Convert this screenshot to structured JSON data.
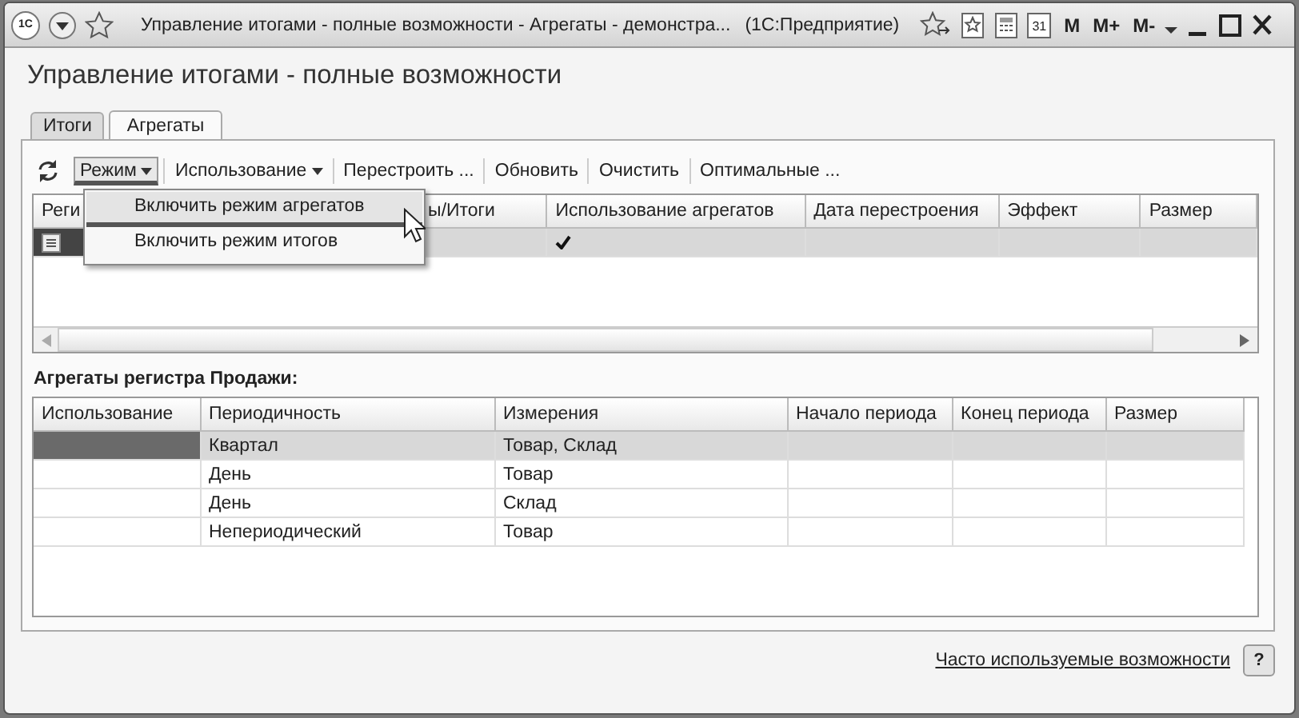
{
  "window": {
    "logo": "1С",
    "title": "Управление итогами - полные возможности - Агрегаты - демонстра...",
    "app": "(1С:Предприятие)",
    "calendar_day": "31",
    "memory_buttons": [
      "M",
      "M+",
      "M-"
    ]
  },
  "form_title": "Управление итогами - полные возможности",
  "tabs": [
    {
      "label": "Итоги",
      "selected": false
    },
    {
      "label": "Агрегаты",
      "selected": true
    }
  ],
  "toolbar": [
    {
      "label": "Режим",
      "dropdown": true,
      "pressed": true
    },
    {
      "label": "Использование",
      "dropdown": true,
      "pressed": false
    },
    {
      "label": "Перестроить ...",
      "dropdown": false,
      "pressed": false
    },
    {
      "label": "Обновить",
      "dropdown": false,
      "pressed": false
    },
    {
      "label": "Очистить",
      "dropdown": false,
      "pressed": false
    },
    {
      "label": "Оптимальные ...",
      "dropdown": false,
      "pressed": false
    }
  ],
  "menu": {
    "items": [
      {
        "label": "Включить режим агрегатов",
        "selected": true
      },
      {
        "label": "Включить режим итогов",
        "selected": false
      }
    ]
  },
  "upper_table": {
    "columns": [
      "Реги",
      "ы/Итоги",
      "Использование агрегатов",
      "Дата перестроения",
      "Эффект",
      "Размер"
    ],
    "rows": [
      {
        "selected": true,
        "usage_checked": true
      }
    ]
  },
  "section_label": "Агрегаты регистра Продажи:",
  "lower_table": {
    "columns": [
      "Использование",
      "Периодичность",
      "Измерения",
      "Начало периода",
      "Конец периода",
      "Размер"
    ],
    "rows": [
      {
        "selected": true,
        "periodicity": "Квартал",
        "dimensions": "Товар, Склад"
      },
      {
        "selected": false,
        "periodicity": "День",
        "dimensions": "Товар"
      },
      {
        "selected": false,
        "periodicity": "День",
        "dimensions": "Склад"
      },
      {
        "selected": false,
        "periodicity": "Непериодический",
        "dimensions": "Товар"
      }
    ]
  },
  "footer": {
    "link": "Часто используемые возможности",
    "help": "?"
  }
}
